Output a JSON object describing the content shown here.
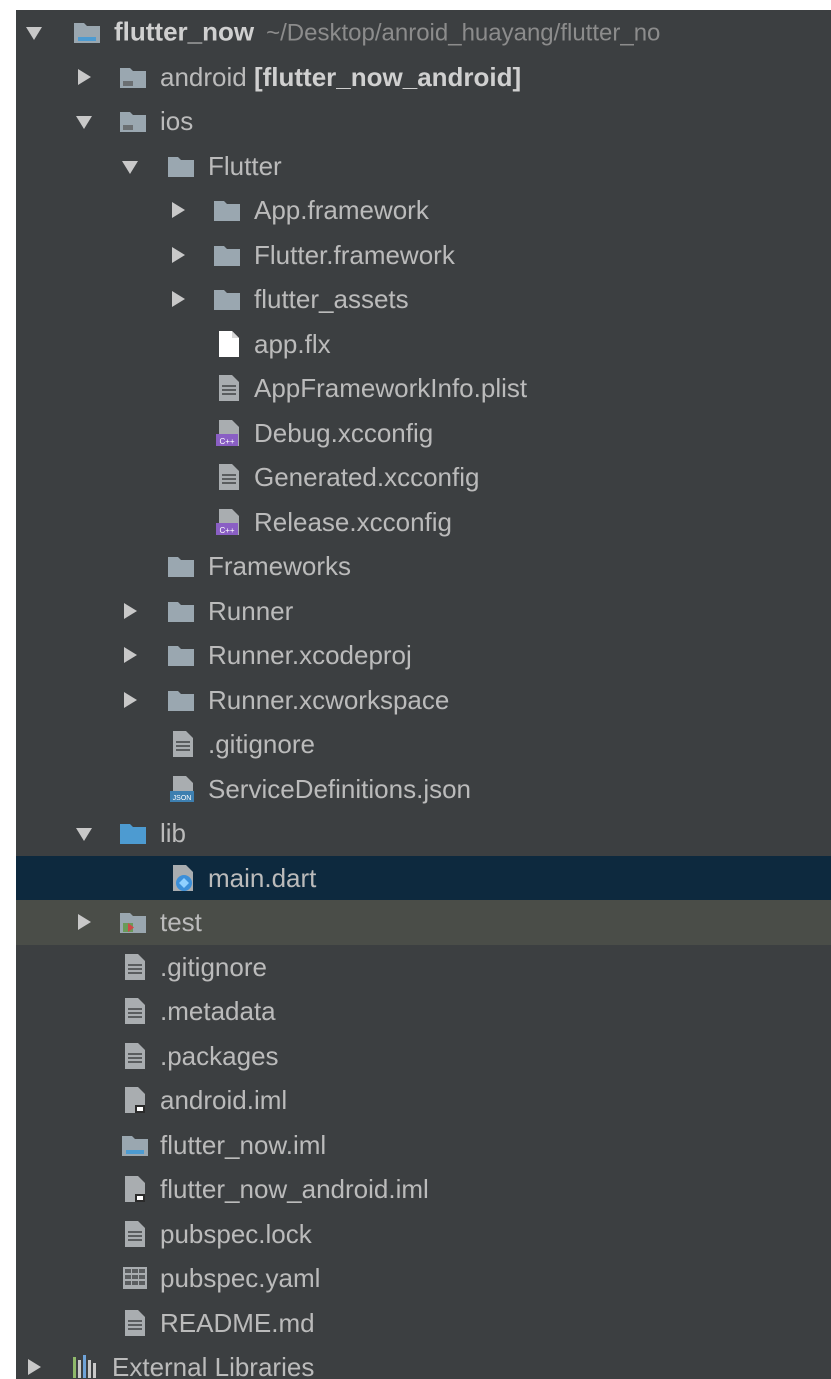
{
  "project_tree": {
    "root": {
      "name": "flutter_now",
      "path": "~/Desktop/anroid_huayang/flutter_no"
    },
    "items": [
      {
        "label": "android",
        "suffix": "[flutter_now_android]",
        "icon": "folder-module-icon",
        "expanded": false,
        "indent": 1
      },
      {
        "label": "ios",
        "icon": "folder-module-icon",
        "expanded": true,
        "indent": 1
      },
      {
        "label": "Flutter",
        "icon": "folder-icon",
        "expanded": true,
        "indent": 2
      },
      {
        "label": "App.framework",
        "icon": "folder-icon",
        "expanded": false,
        "indent": 3
      },
      {
        "label": "Flutter.framework",
        "icon": "folder-icon",
        "expanded": false,
        "indent": 3
      },
      {
        "label": "flutter_assets",
        "icon": "folder-icon",
        "expanded": false,
        "indent": 3
      },
      {
        "label": "app.flx",
        "icon": "blank-file-icon",
        "indent": 3
      },
      {
        "label": "AppFrameworkInfo.plist",
        "icon": "text-file-icon",
        "indent": 3
      },
      {
        "label": "Debug.xcconfig",
        "icon": "cpp-file-icon",
        "indent": 3
      },
      {
        "label": "Generated.xcconfig",
        "icon": "text-file-icon",
        "indent": 3
      },
      {
        "label": "Release.xcconfig",
        "icon": "cpp-file-icon",
        "indent": 3
      },
      {
        "label": "Frameworks",
        "icon": "folder-icon",
        "indent": 2
      },
      {
        "label": "Runner",
        "icon": "folder-icon",
        "expanded": false,
        "indent": 2
      },
      {
        "label": "Runner.xcodeproj",
        "icon": "folder-icon",
        "expanded": false,
        "indent": 2
      },
      {
        "label": "Runner.xcworkspace",
        "icon": "folder-icon",
        "expanded": false,
        "indent": 2
      },
      {
        "label": ".gitignore",
        "icon": "text-file-icon",
        "indent": 2
      },
      {
        "label": "ServiceDefinitions.json",
        "icon": "json-file-icon",
        "indent": 2
      },
      {
        "label": "lib",
        "icon": "folder-source-icon",
        "expanded": true,
        "indent": 1
      },
      {
        "label": "main.dart",
        "icon": "dart-file-icon",
        "indent": 2,
        "selected": true
      },
      {
        "label": "test",
        "icon": "folder-test-icon",
        "expanded": false,
        "indent": 1,
        "highlight": true
      },
      {
        "label": ".gitignore",
        "icon": "text-file-icon",
        "indent": 1
      },
      {
        "label": ".metadata",
        "icon": "text-file-icon",
        "indent": 1
      },
      {
        "label": ".packages",
        "icon": "text-file-icon",
        "indent": 1
      },
      {
        "label": "android.iml",
        "icon": "iml-file-icon",
        "indent": 1
      },
      {
        "label": "flutter_now.iml",
        "icon": "module-file-icon",
        "indent": 1
      },
      {
        "label": "flutter_now_android.iml",
        "icon": "iml-file-icon",
        "indent": 1
      },
      {
        "label": "pubspec.lock",
        "icon": "text-file-icon",
        "indent": 1
      },
      {
        "label": "pubspec.yaml",
        "icon": "yaml-file-icon",
        "indent": 1
      },
      {
        "label": "README.md",
        "icon": "text-file-icon",
        "indent": 1
      }
    ],
    "external": {
      "label": "External Libraries",
      "icon": "library-icon",
      "expanded": false
    }
  },
  "colors": {
    "panel_bg": "#3c3f41",
    "selected_bg": "#0d293e",
    "highlight_bg": "#4a4d48",
    "text": "#bbbbbb",
    "folder": "#9aa7b0",
    "source_folder": "#4d9bd1"
  }
}
